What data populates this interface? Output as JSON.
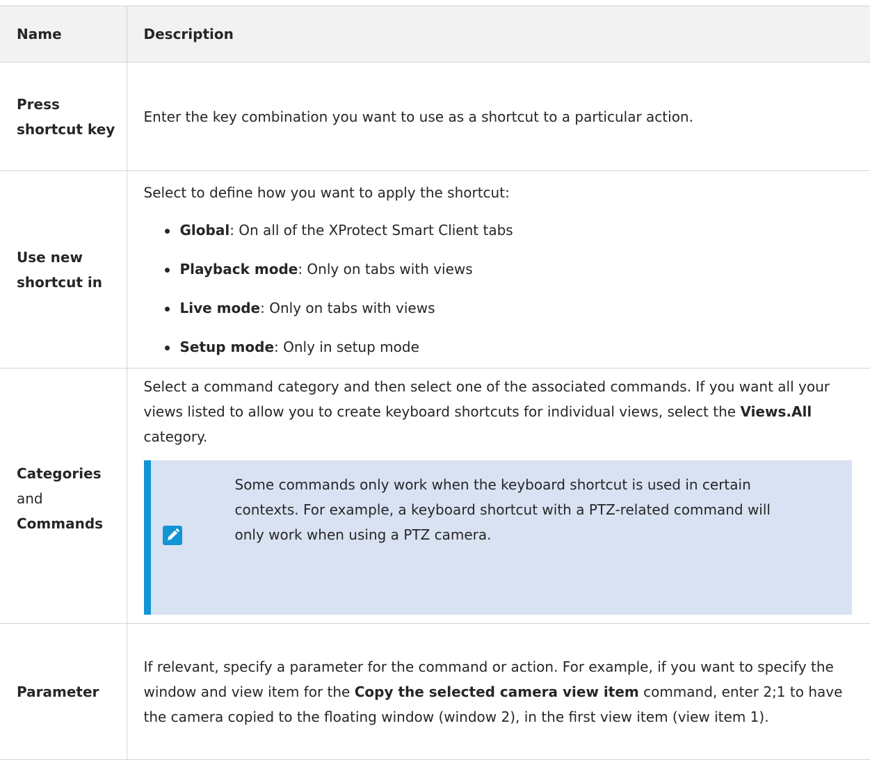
{
  "table": {
    "header": {
      "name": "Name",
      "description": "Description"
    },
    "rows": [
      {
        "name": "Press shortcut key",
        "description": "Enter the key combination you want to use as a shortcut to a particular action."
      },
      {
        "name": "Use new shortcut in",
        "intro": "Select to define how you want to apply the shortcut:",
        "options": [
          {
            "term": "Global",
            "text": ": On all of the XProtect Smart Client tabs"
          },
          {
            "term": "Playback mode",
            "text": ": Only on tabs with views"
          },
          {
            "term": "Live mode",
            "text": ": Only on tabs with views"
          },
          {
            "term": "Setup mode",
            "text": ": Only in setup mode"
          }
        ]
      },
      {
        "name_part1": "Categories",
        "name_part2": "and",
        "name_part3": "Commands",
        "description_before": "Select a command category and then select one of the associated commands. If you want all your views listed to allow you to create keyboard shortcuts for individual views, select the ",
        "description_bold": "Views.All",
        "description_after": " category.",
        "note": {
          "icon": "pencil-icon",
          "text": "Some commands only work when the keyboard shortcut is used in certain contexts. For example, a keyboard shortcut with a PTZ-related command will only work when using a PTZ camera."
        }
      },
      {
        "name": "Parameter",
        "description_before": "If relevant, specify a parameter for the command or action. For example, if you want to specify the window and view item for the ",
        "description_bold": "Copy the selected camera view item",
        "description_after": " command, enter 2;1 to have the camera copied to the floating window (window 2), in the first view item (view item 1)."
      }
    ]
  },
  "colors": {
    "header_bg": "#f2f2f2",
    "note_bg": "#d9e2f3",
    "note_accent": "#1394d5",
    "border": "#d4d4d4"
  }
}
